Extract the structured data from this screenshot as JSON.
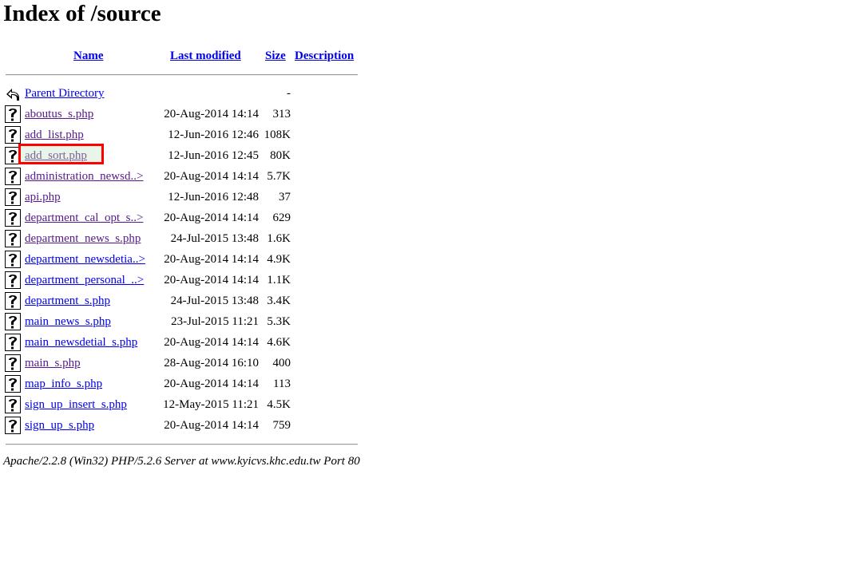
{
  "title": "Index of /source",
  "columns": {
    "name": "Name",
    "last_modified": "Last modified",
    "size": "Size",
    "description": "Description"
  },
  "parent": {
    "name": "Parent Directory",
    "date": "",
    "size": "-"
  },
  "files": [
    {
      "name": "aboutus_s.php",
      "date": "20-Aug-2014 14:14",
      "size": "313",
      "visited": true
    },
    {
      "name": "add_list.php",
      "date": "12-Jun-2016 12:46",
      "size": "108K",
      "visited": true
    },
    {
      "name": "add_sort.php",
      "date": "12-Jun-2016 12:45",
      "size": "80K",
      "visited": true
    },
    {
      "name": "administration_newsd..>",
      "date": "20-Aug-2014 14:14",
      "size": "5.7K",
      "visited": true
    },
    {
      "name": "api.php",
      "date": "12-Jun-2016 12:48",
      "size": "37",
      "visited": true
    },
    {
      "name": "department_cal_opt_s..>",
      "date": "20-Aug-2014 14:14",
      "size": "629",
      "visited": true
    },
    {
      "name": "department_news_s.php",
      "date": "24-Jul-2015 13:48",
      "size": "1.6K",
      "visited": true
    },
    {
      "name": "department_newsdetia..>",
      "date": "20-Aug-2014 14:14",
      "size": "4.9K",
      "visited": false
    },
    {
      "name": "department_personal_..>",
      "date": "20-Aug-2014 14:14",
      "size": "1.1K",
      "visited": false
    },
    {
      "name": "department_s.php",
      "date": "24-Jul-2015 13:48",
      "size": "3.4K",
      "visited": false
    },
    {
      "name": "main_news_s.php",
      "date": "23-Jul-2015 11:21",
      "size": "5.3K",
      "visited": false
    },
    {
      "name": "main_newsdetial_s.php",
      "date": "20-Aug-2014 14:14",
      "size": "4.6K",
      "visited": false
    },
    {
      "name": "main_s.php",
      "date": "28-Aug-2014 16:10",
      "size": "400",
      "visited": true
    },
    {
      "name": "map_info_s.php",
      "date": "20-Aug-2014 14:14",
      "size": "113",
      "visited": false
    },
    {
      "name": "sign_up_insert_s.php",
      "date": "12-May-2015 11:21",
      "size": "4.5K",
      "visited": false
    },
    {
      "name": "sign_up_s.php",
      "date": "20-Aug-2014 14:14",
      "size": "759",
      "visited": false
    }
  ],
  "footer": "Apache/2.2.8 (Win32) PHP/5.2.6 Server at www.kyicvs.khc.edu.tw Port 80",
  "colors": {
    "link": "#0000ee",
    "visited_link": "#551a8b",
    "highlight_border": "#ff0000"
  },
  "icons": {
    "parent": "back-arrow-icon",
    "file": "unknown-file-icon"
  }
}
